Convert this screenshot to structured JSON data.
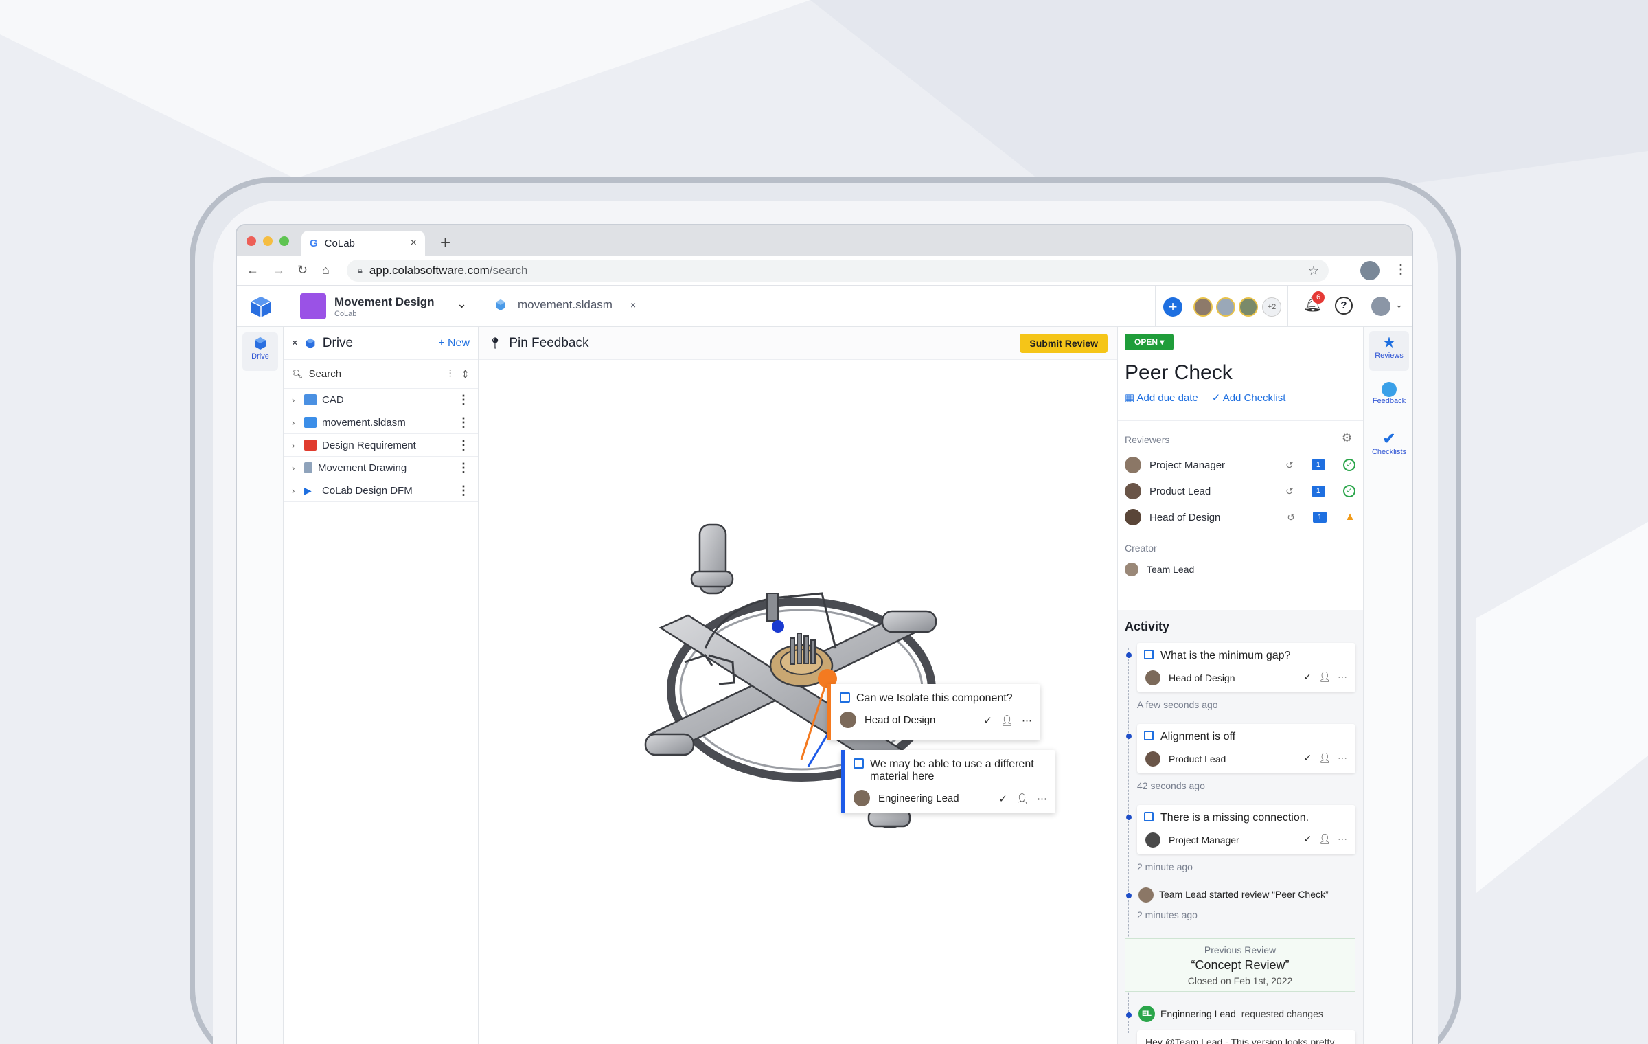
{
  "browser": {
    "tab_title": "CoLab",
    "tab_close": "×",
    "new_tab": "+",
    "url_host": "app.colabsoftware.com",
    "url_path": "/search"
  },
  "app_header": {
    "project_name": "Movement Design",
    "project_org": "CoLab",
    "open_file_tab": "movement.sldasm",
    "open_file_close": "×",
    "extra_collaborators": "+2",
    "notification_count": "6",
    "help": "?"
  },
  "left_rail": {
    "items": [
      {
        "label": "Drive",
        "icon": "cube-icon"
      }
    ]
  },
  "drive": {
    "close": "×",
    "title": "Drive",
    "new_label": "+ New",
    "search_placeholder": "Search",
    "items": [
      {
        "name": "CAD",
        "icon": "folder-icon",
        "color": "#4a90e2"
      },
      {
        "name": "movement.sldasm",
        "icon": "cube-icon",
        "color": "#3b8ee8"
      },
      {
        "name": "Design Requirement",
        "icon": "pdf-icon",
        "color": "#e03b2e"
      },
      {
        "name": "Movement Drawing",
        "icon": "drawing-icon",
        "color": "#8fa3bb"
      },
      {
        "name": "CoLab Design DFM",
        "icon": "play-icon",
        "color": "#1e6fe0"
      }
    ]
  },
  "viewer": {
    "title": "Pin Feedback",
    "submit_label": "Submit Review",
    "callouts": [
      {
        "question": "Can we Isolate this component?",
        "author": "Head of Design",
        "color": "#f47a20"
      },
      {
        "question": "We may be able to use a different material here",
        "author": "Engineering Lead",
        "color": "#1e5be8"
      }
    ]
  },
  "review": {
    "status": "OPEN ▾",
    "title": "Peer Check",
    "add_due_date": "Add due date",
    "add_checklist": "Add Checklist",
    "reviewers_label": "Reviewers",
    "reviewers": [
      {
        "name": "Project Manager",
        "count": "1",
        "status": "approved"
      },
      {
        "name": "Product Lead",
        "count": "1",
        "status": "approved"
      },
      {
        "name": "Head of Design",
        "count": "1",
        "status": "warning"
      }
    ],
    "creator_label": "Creator",
    "creator": "Team Lead",
    "activity_title": "Activity",
    "activity": [
      {
        "text": "What is the minimum gap?",
        "author": "Head of Design",
        "time": "A few seconds ago"
      },
      {
        "text": "Alignment is off",
        "author": "Product Lead",
        "time": "42 seconds ago"
      },
      {
        "text": "There is a missing connection.",
        "author": "Project Manager",
        "time": "2 minute ago"
      }
    ],
    "started_event": "Team Lead started review “Peer Check”",
    "started_time": "2 minutes ago",
    "previous_review": {
      "label": "Previous Review",
      "name": "“Concept Review”",
      "closed": "Closed on Feb 1st, 2022"
    },
    "change_event": {
      "initials": "EL",
      "who": "Enginnering Lead",
      "action": "requested changes",
      "comment": "Hey @Team Lead - This version looks pretty good, but I left you a few comments"
    }
  },
  "right_rail": {
    "items": [
      {
        "label": "Reviews",
        "icon": "star-icon"
      },
      {
        "label": "Feedback",
        "icon": "feedback-icon"
      },
      {
        "label": "Checklists",
        "icon": "checklist-icon"
      }
    ]
  }
}
